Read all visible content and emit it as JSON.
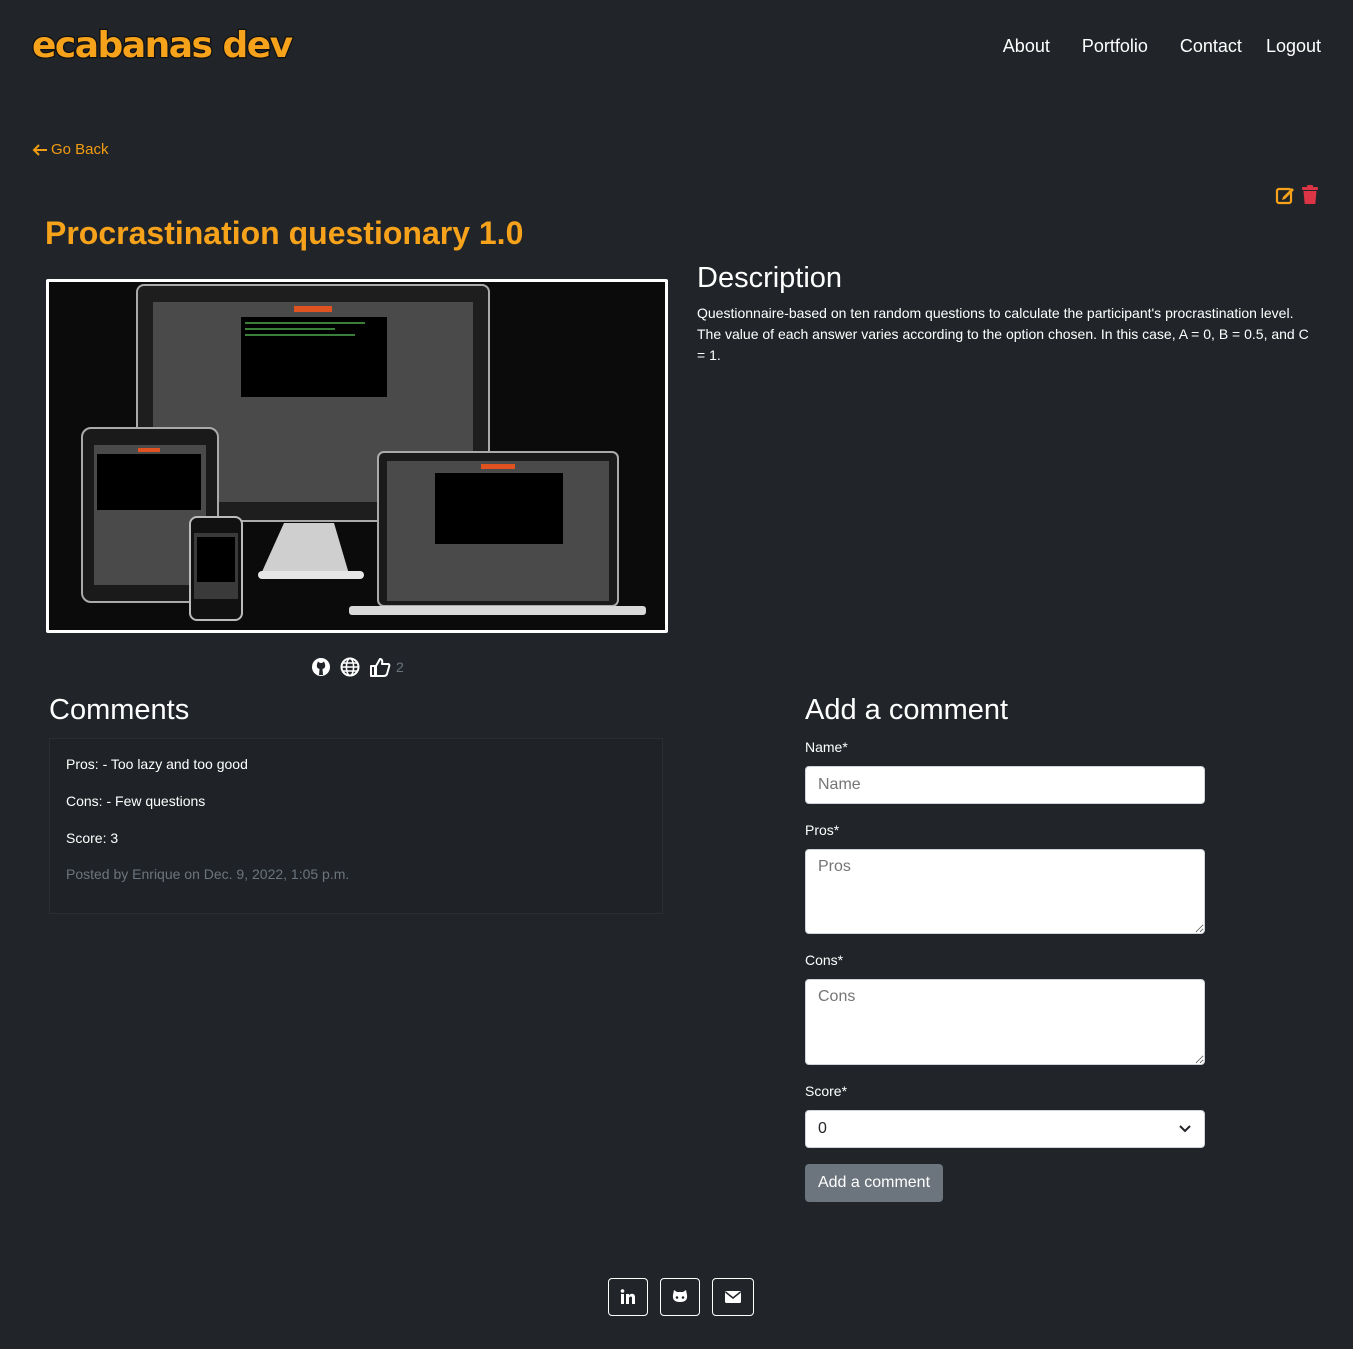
{
  "brand": {
    "logo_text": "ecabanas dev"
  },
  "nav": {
    "items": [
      "About",
      "Portfolio",
      "Contact",
      "Logout"
    ]
  },
  "go_back": {
    "label": "Go Back"
  },
  "project": {
    "title": "Procrastination questionary 1.0",
    "likes": "2",
    "description_title": "Description",
    "description": "Questionnaire-based on ten random questions to calculate the participant's procrastination level. The value of each answer varies according to the option chosen. In this case, A = 0, B = 0.5, and C = 1."
  },
  "comments": {
    "title": "Comments",
    "items": [
      {
        "pros": "Pros: - Too lazy and too good",
        "cons": "Cons: - Few questions",
        "score": "Score: 3",
        "meta": "Posted by Enrique on Dec. 9, 2022, 1:05 p.m."
      }
    ]
  },
  "form": {
    "title": "Add a comment",
    "name_label": "Name*",
    "name_placeholder": "Name",
    "pros_label": "Pros*",
    "pros_placeholder": "Pros",
    "cons_label": "Cons*",
    "cons_placeholder": "Cons",
    "score_label": "Score*",
    "score_value": "0",
    "submit_label": "Add a comment"
  },
  "colors": {
    "background": "#212529",
    "accent": "#f7a21b",
    "danger": "#dc3545",
    "secondary": "#6c757d"
  },
  "icons": [
    "arrow-left-icon",
    "edit-icon",
    "trash-icon",
    "github-icon",
    "globe-icon",
    "thumbs-up-icon",
    "linkedin-icon",
    "github-alt-icon",
    "envelope-icon"
  ]
}
